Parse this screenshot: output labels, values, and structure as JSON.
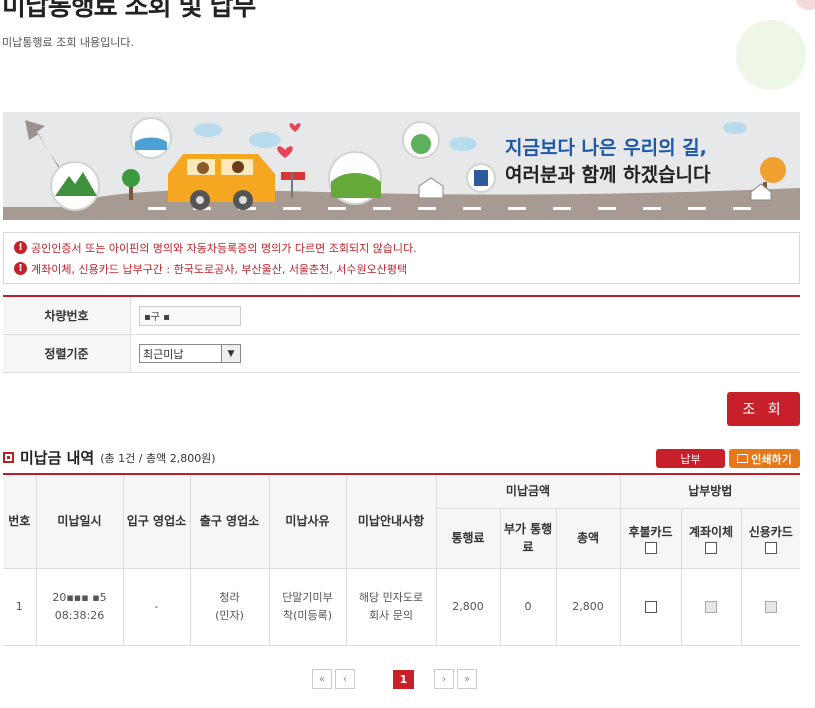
{
  "page": {
    "title": "미납통행료 조회 및 납부",
    "subtitle": "미납통행료 조회 내용입니다."
  },
  "banner": {
    "line1": "지금보다 나은 우리의 길,",
    "line2": "여러분과 함께 하겠습니다"
  },
  "notices": [
    "공인인증서 또는 아이핀의 명의와 자동차등록증의 명의가 다르면 조회되지 않습니다.",
    "계좌이체, 신용카드 납부구간 : 한국도로공사, 부산울산, 서울춘천, 서수원오산평택"
  ],
  "form": {
    "vehicle_label": "차량번호",
    "vehicle_value": "▪구 ▪",
    "sort_label": "정렬기준",
    "sort_value": "최근미납"
  },
  "buttons": {
    "search": "조 회",
    "pay": "납부",
    "print": "인쇄하기"
  },
  "section": {
    "title": "미납금 내역",
    "summary": "(총 1건 / 총액 2,800원)"
  },
  "table": {
    "headers": {
      "no": "번호",
      "date": "미납일시",
      "entry": "입구 영업소",
      "exit": "출구 영업소",
      "reason": "미납사유",
      "guide": "미납안내사항",
      "amount_group": "미납금액",
      "toll": "통행료",
      "extra": "부가 통행료",
      "total": "총액",
      "pay_group": "납부방법",
      "postpaid": "후불카드",
      "transfer": "계좌이체",
      "credit": "신용카드"
    },
    "rows": [
      {
        "no": "1",
        "date": "20▪▪▪ ▪5",
        "time": "08:38:26",
        "entry": "-",
        "exit": "청라",
        "exit_type": "(민자)",
        "reason": "단말기미부착(미등록)",
        "guide": "해당 민자도로 회사 문의",
        "toll": "2,800",
        "extra": "0",
        "total": "2,800"
      }
    ]
  },
  "pagination": {
    "first": "«",
    "prev": "‹",
    "current": "1",
    "next": "›",
    "last": "»"
  },
  "colors": {
    "accent": "#c8202b",
    "print": "#e67817",
    "banner_blue": "#1d57a6"
  }
}
